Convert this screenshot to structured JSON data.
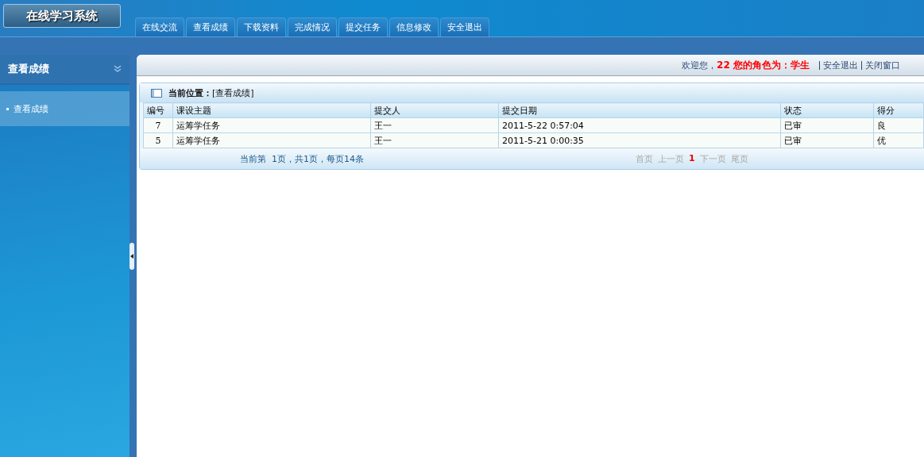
{
  "header": {
    "logo": "在线学习系统",
    "tabs": [
      "在线交流",
      "查看成绩",
      "下载资料",
      "完成情况",
      "提交任务",
      "信息修改",
      "安全退出"
    ]
  },
  "sidebar": {
    "title": "查看成绩",
    "items": [
      "查看成绩"
    ]
  },
  "topbar": {
    "welcome": "欢迎您，**22 您的角色为：学生**",
    "links": [
      "安全退出",
      "关闭窗口"
    ]
  },
  "panel": {
    "location_label": "当前位置：",
    "location": "[查看成绩]",
    "columns": [
      "编号",
      "课设主题",
      "提交人",
      "提交日期",
      "状态",
      "得分"
    ],
    "rows": [
      [
        "7",
        "运筹学任务",
        "王一",
        "2011-5-22 0:57:04",
        "已审",
        "良"
      ],
      [
        "5",
        "运筹学任务",
        "王一",
        "2011-5-21 0:00:35",
        "已审",
        "优"
      ]
    ],
    "page_info": "当前第  1页，共1页，每页14条",
    "pager": [
      {
        "label": "首页",
        "selected": false
      },
      {
        "label": "上一页",
        "selected": false
      },
      {
        "label": "1",
        "selected": true
      },
      {
        "label": "下一页",
        "selected": false
      },
      {
        "label": "尾页",
        "selected": false
      }
    ]
  }
}
